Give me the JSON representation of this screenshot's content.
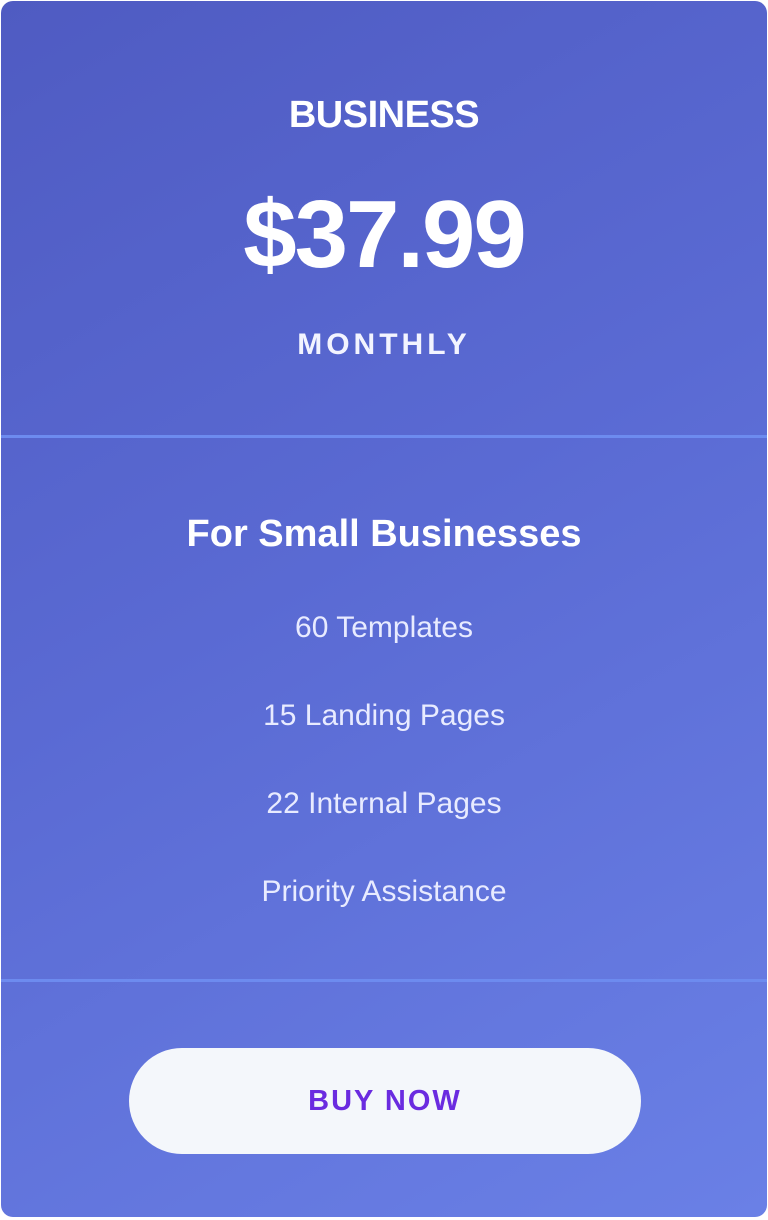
{
  "plan": {
    "name": "BUSINESS",
    "price": "$37.99",
    "period": "MONTHLY"
  },
  "features": {
    "title": "For Small Businesses",
    "items": [
      "60 Templates",
      "15 Landing Pages",
      "22 Internal Pages",
      "Priority Assistance"
    ]
  },
  "cta": {
    "label": "BUY NOW"
  },
  "colors": {
    "gradient_start": "#4f5bc2",
    "gradient_end": "#6a80e6",
    "divider": "#6d8bef",
    "button_bg": "#f4f7fb",
    "button_text": "#6a2be0"
  }
}
